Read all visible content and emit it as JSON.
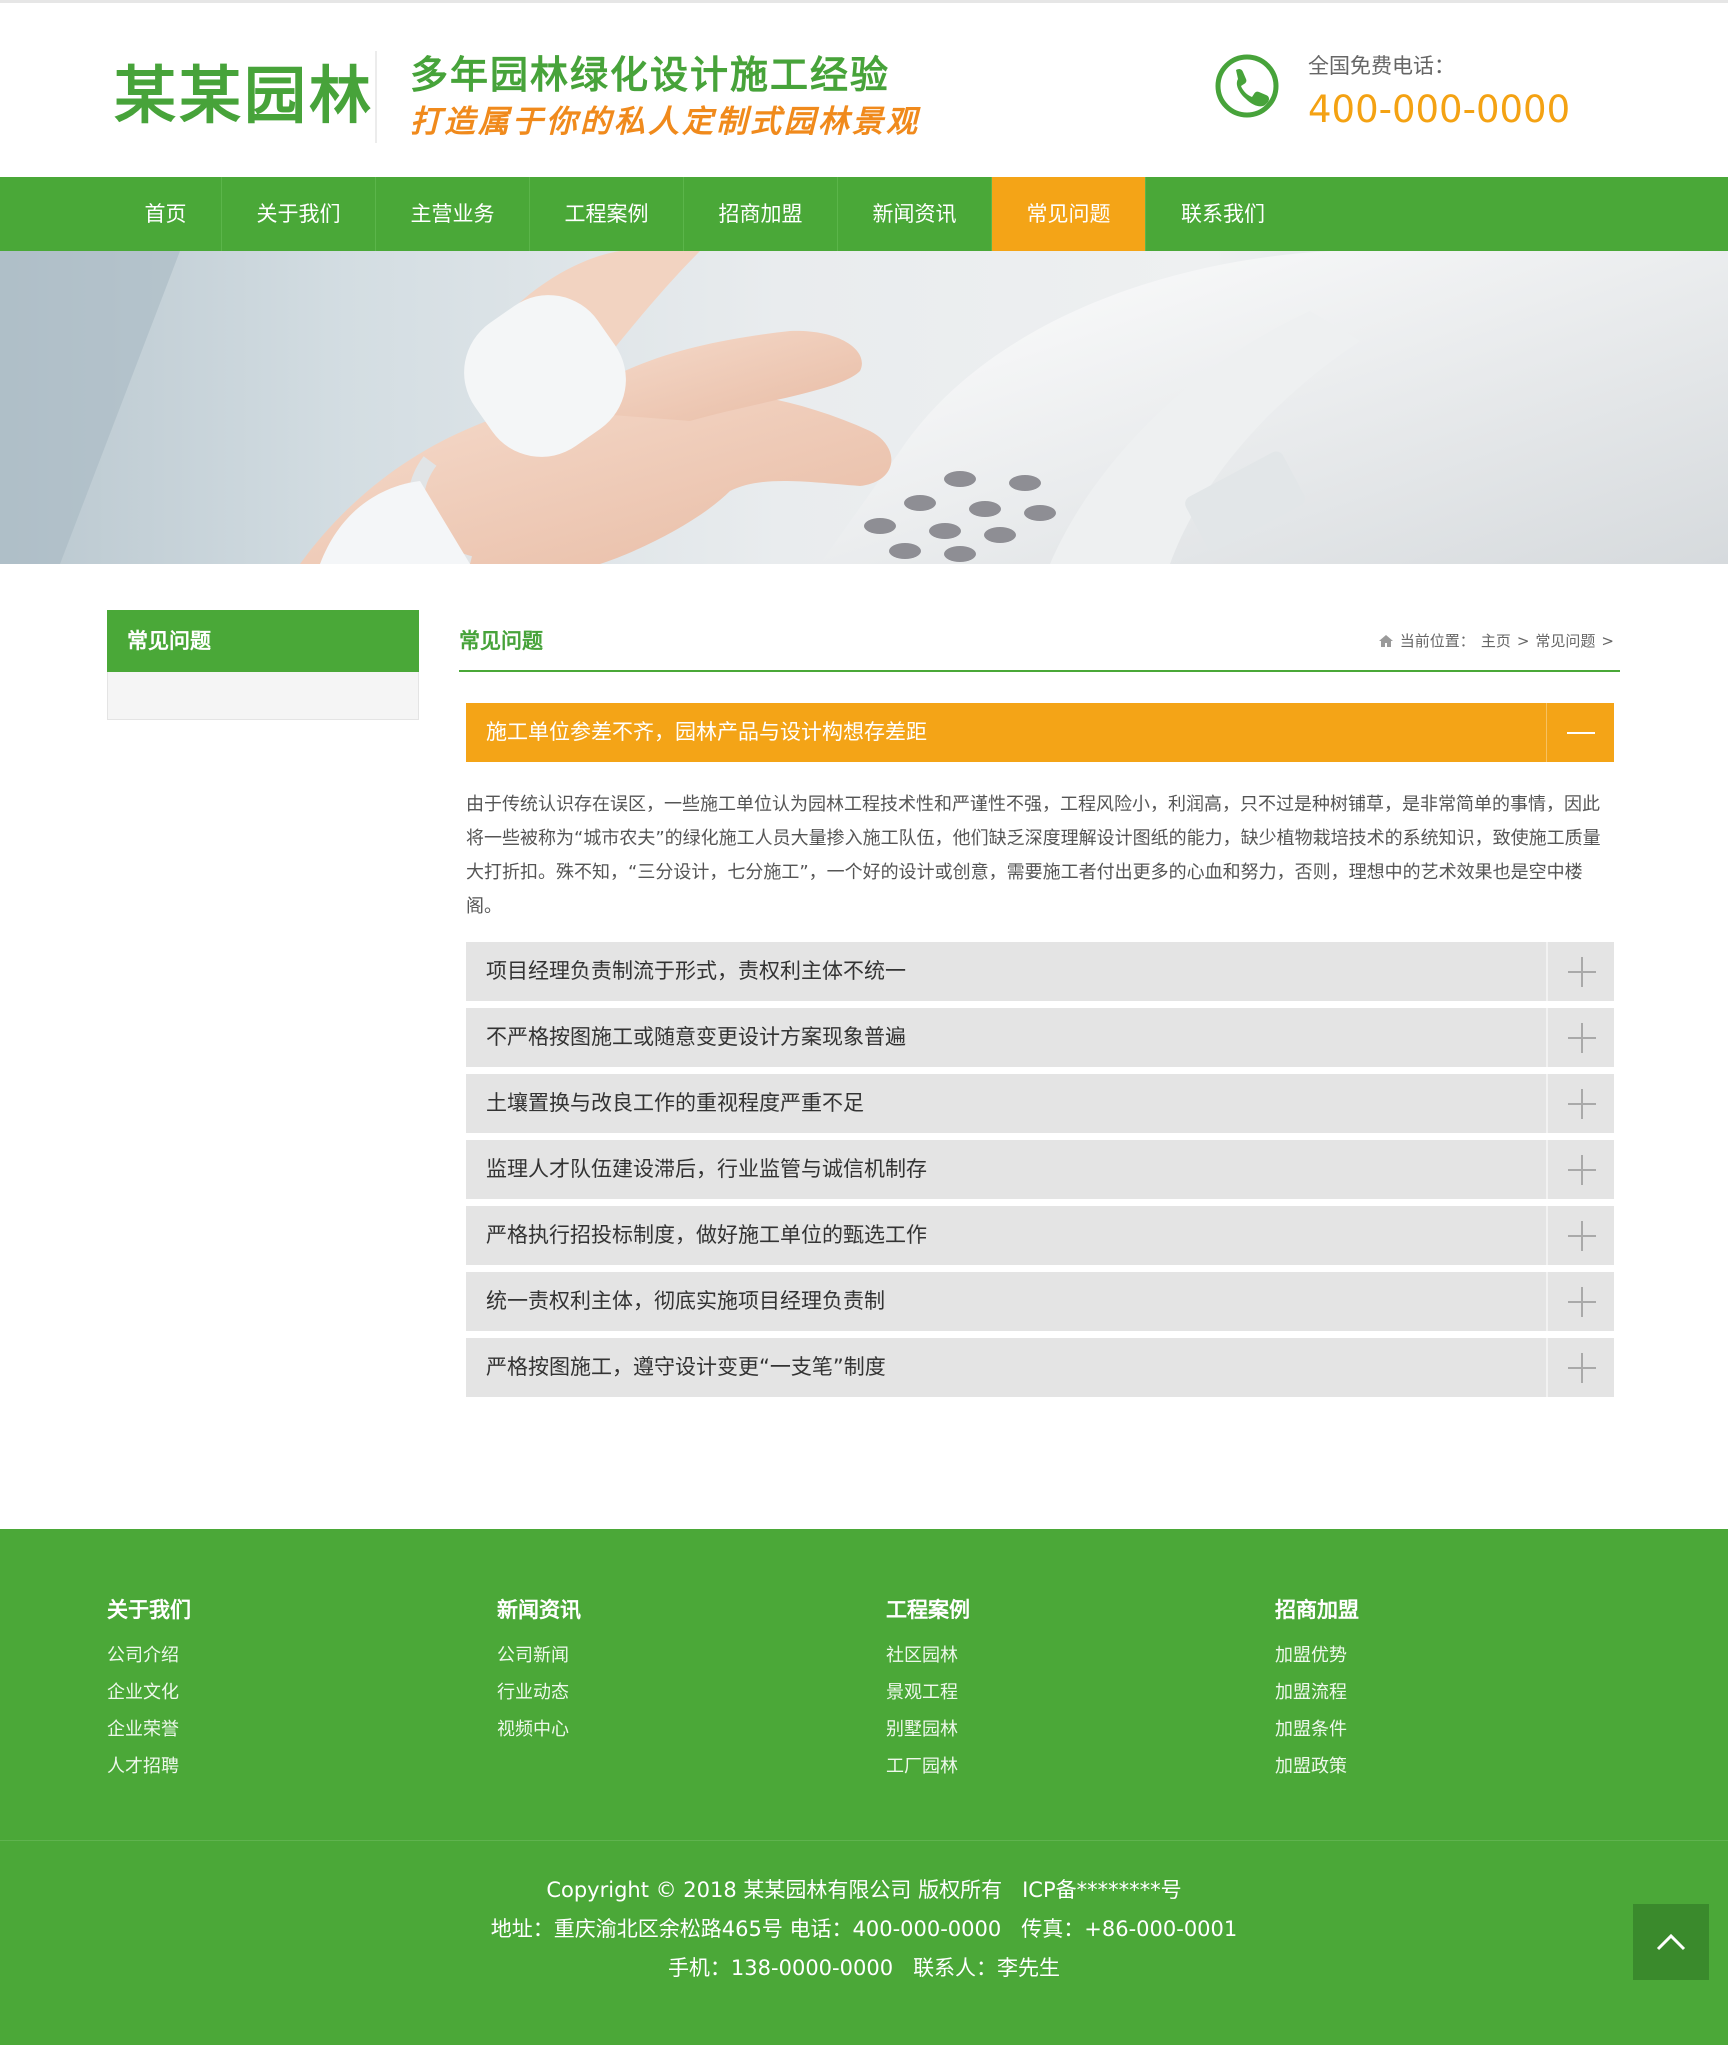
{
  "header": {
    "logo_text": "某某园林",
    "slogan_line1": "多年园林绿化设计施工经验",
    "slogan_line2": "打造属于你的私人定制式园林景观",
    "phone_label": "全国免费电话：",
    "phone_number": "400-000-0000"
  },
  "nav": {
    "items": [
      "首页",
      "关于我们",
      "主营业务",
      "工程案例",
      "招商加盟",
      "新闻资讯",
      "常见问题",
      "联系我们"
    ],
    "active": "常见问题"
  },
  "sidebar": {
    "title": "常见问题"
  },
  "main": {
    "title": "常见问题",
    "breadcrumb": {
      "label": "当前位置：",
      "home": "主页",
      "sep": ">",
      "current": "常见问题",
      "tail": ">"
    }
  },
  "faq": {
    "open": {
      "question": "施工单位参差不齐，园林产品与设计构想存差距",
      "answer": "由于传统认识存在误区，一些施工单位认为园林工程技术性和严谨性不强，工程风险小，利润高，只不过是种树铺草，是非常简单的事情，因此将一些被称为“城市农夫”的绿化施工人员大量掺入施工队伍，他们缺乏深度理解设计图纸的能力，缺少植物栽培技术的系统知识，致使施工质量大打折扣。殊不知，“三分设计，七分施工”，一个好的设计或创意，需要施工者付出更多的心血和努力，否则，理想中的艺术效果也是空中楼阁。"
    },
    "items": [
      "项目经理负责制流于形式，责权利主体不统一",
      "不严格按图施工或随意变更设计方案现象普遍",
      "土壤置换与改良工作的重视程度严重不足",
      "监理人才队伍建设滞后，行业监管与诚信机制存",
      "严格执行招投标制度，做好施工单位的甄选工作",
      "统一责权利主体，彻底实施项目经理负责制",
      "严格按图施工，遵守设计变更“一支笔”制度"
    ]
  },
  "footer": {
    "columns": [
      {
        "title": "关于我们",
        "links": [
          "公司介绍",
          "企业文化",
          "企业荣誉",
          "人才招聘"
        ]
      },
      {
        "title": "新闻资讯",
        "links": [
          "公司新闻",
          "行业动态",
          "视频中心"
        ]
      },
      {
        "title": "工程案例",
        "links": [
          "社区园林",
          "景观工程",
          "别墅园林",
          "工厂园林"
        ]
      },
      {
        "title": "招商加盟",
        "links": [
          "加盟优势",
          "加盟流程",
          "加盟条件",
          "加盟政策"
        ]
      }
    ],
    "copyright": "Copyright © 2018 某某园林有限公司 版权所有",
    "icp": "ICP备********号",
    "address": "地址：重庆渝北区余松路465号 电话：400-000-0000",
    "fax": "传真：+86-000-0001",
    "mobile": "手机：138-0000-0000",
    "contact": "联系人：李先生"
  },
  "colors": {
    "brand_green": "#4aa838",
    "accent_orange": "#f4a417",
    "phone_orange": "#f4a213"
  }
}
